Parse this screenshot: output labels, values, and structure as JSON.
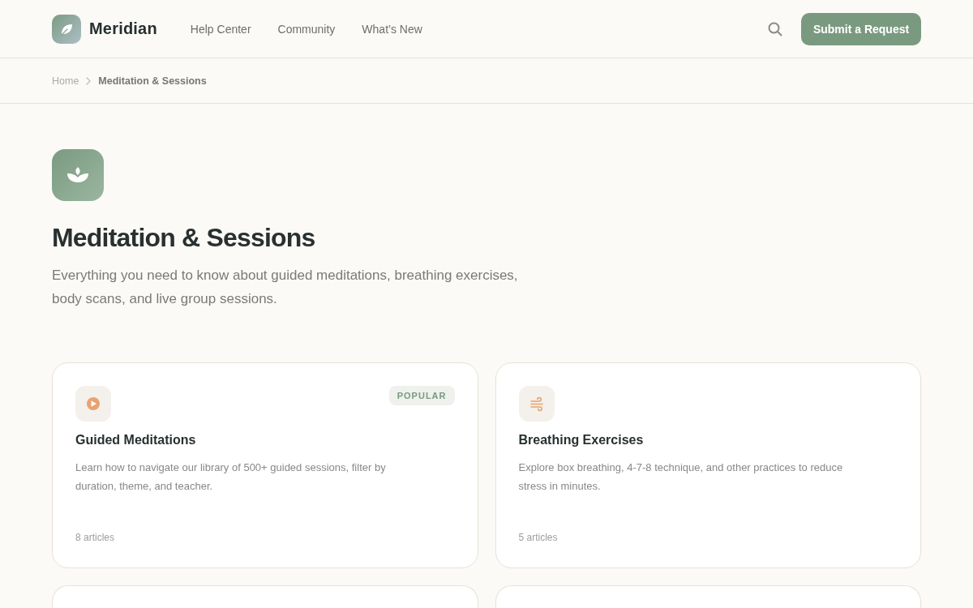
{
  "brand": {
    "name": "Meridian"
  },
  "nav": [
    {
      "label": "Help Center"
    },
    {
      "label": "Community"
    },
    {
      "label": "What’s New"
    }
  ],
  "header_button": {
    "label": "Submit a Request"
  },
  "breadcrumb": [
    {
      "label": "Home",
      "current": false
    },
    {
      "label": "Meditation & Sessions",
      "current": true
    }
  ],
  "hero": {
    "title": "Meditation & Sessions",
    "description": "Everything you need to know about guided meditations, breathing exercises, body scans, and live group sessions."
  },
  "categories": [
    {
      "kind": "full",
      "title": "Guided Meditations",
      "description": "Learn how to navigate our library of 500+ guided sessions, filter by duration, theme, and teacher.",
      "badge": "POPULAR",
      "count": "8 articles"
    },
    {
      "kind": "full",
      "title": "Breathing Exercises",
      "description": "Explore box breathing, 4-7-8 technique, and other practices to reduce stress in minutes.",
      "count": "5 articles"
    },
    {
      "kind": "partial"
    },
    {
      "kind": "partial"
    }
  ]
}
